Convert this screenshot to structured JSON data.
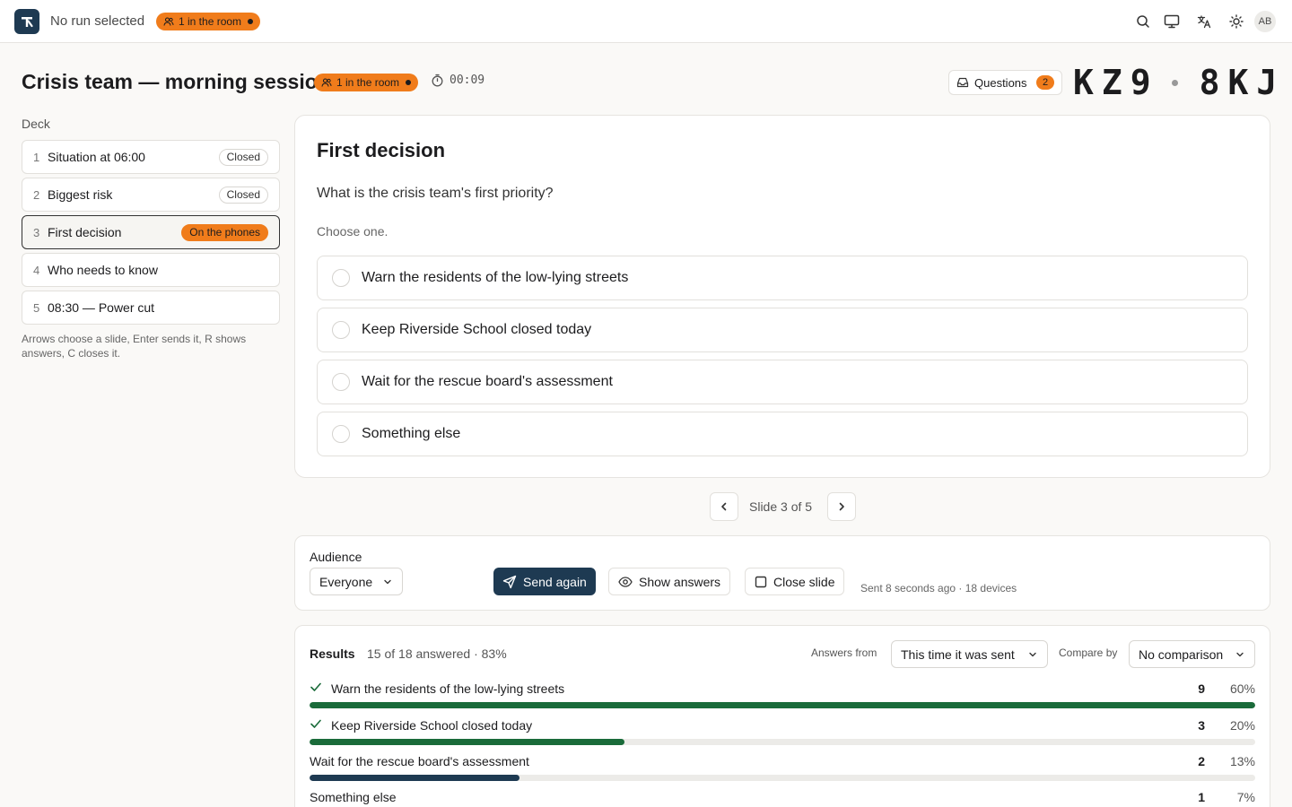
{
  "topbar": {
    "run_label": "No run selected",
    "room_pill": "1 in the room",
    "avatar_initials": "AB",
    "icons": [
      "search-icon",
      "monitor-icon",
      "translate-icon",
      "sun-icon"
    ]
  },
  "session": {
    "title": "Crisis team — morning session",
    "room_pill": "1 in the room",
    "timer": "00:09",
    "questions_label": "Questions",
    "questions_count": "2",
    "room_code_a": "KZ9",
    "room_code_b": "8KJ"
  },
  "deck": {
    "title": "Deck",
    "items": [
      {
        "num": "1",
        "label": "Situation at 06:00",
        "status": "Closed"
      },
      {
        "num": "2",
        "label": "Biggest risk",
        "status": "Closed"
      },
      {
        "num": "3",
        "label": "First decision",
        "status": "On the phones"
      },
      {
        "num": "4",
        "label": "Who needs to know",
        "status": ""
      },
      {
        "num": "5",
        "label": "08:30 — Power cut",
        "status": ""
      }
    ],
    "hint": "Arrows choose a slide, Enter sends it, R shows answers, C closes it."
  },
  "slide": {
    "title": "First decision",
    "question": "What is the crisis team's first priority?",
    "hint": "Choose one.",
    "options": [
      "Warn the residents of the low-lying streets",
      "Keep Riverside School closed today",
      "Wait for the rescue board's assessment",
      "Something else"
    ],
    "counter": "Slide 3 of 5"
  },
  "audience": {
    "label": "Audience",
    "select_value": "Everyone",
    "send_again": "Send again",
    "show_answers": "Show answers",
    "close_slide": "Close slide",
    "sent_info": "Sent 8 seconds ago · 18 devices"
  },
  "results": {
    "title": "Results",
    "summary": "15 of 18 answered · 83%",
    "from_label": "Answers from",
    "from_value": "This time it was sent",
    "compare_label": "Compare by",
    "compare_value": "No comparison",
    "rows": [
      {
        "label": "Warn the residents of the low-lying streets",
        "count": "9",
        "pct": "60%",
        "fraction": 1.0,
        "checked": true,
        "color": "#1a6b3a"
      },
      {
        "label": "Keep Riverside School closed today",
        "count": "3",
        "pct": "20%",
        "fraction": 0.333,
        "checked": true,
        "color": "#1a6b3a"
      },
      {
        "label": "Wait for the rescue board's assessment",
        "count": "2",
        "pct": "13%",
        "fraction": 0.222,
        "checked": false,
        "color": "#1e3a52"
      },
      {
        "label": "Something else",
        "count": "1",
        "pct": "7%",
        "fraction": 0.111,
        "checked": false,
        "color": "#1e3a52"
      }
    ]
  },
  "colors": {
    "accent": "#f07c1b",
    "primary": "#1e3a52",
    "success": "#1a6b3a"
  }
}
